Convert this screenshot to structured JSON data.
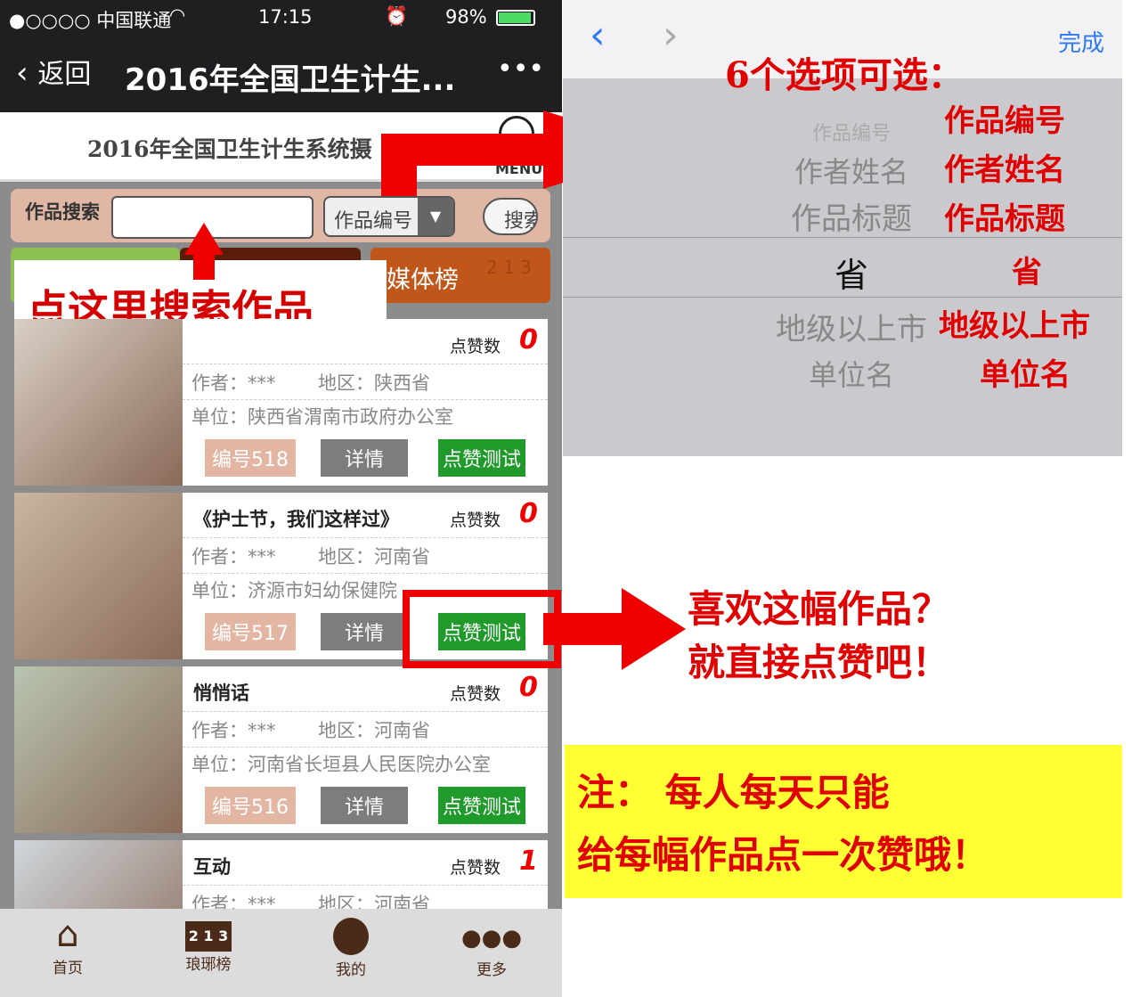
{
  "status": {
    "carrier": "●○○○○ 中国联通",
    "time": "17:15",
    "battery": "98%"
  },
  "nav": {
    "back": "返回",
    "title": "2016年全国卫生计生...",
    "more": "•••"
  },
  "header": {
    "title": "2016年全国卫生计生系统摄",
    "menu": "MENU"
  },
  "search": {
    "label": "作品搜索",
    "value": "",
    "select": "作品编号",
    "button": "搜索"
  },
  "tabs": [
    {
      "label": "媒体榜",
      "color": "#c0561a"
    }
  ],
  "overlay": {
    "search_hint": "点这里搜索作品"
  },
  "cards": [
    {
      "title": "",
      "likes_label": "点赞数",
      "likes": "0",
      "author": "作者：***",
      "region": "地区：陕西省",
      "unit": "单位：陕西省渭南市政府办公室",
      "id": "编号518",
      "detail": "详情",
      "vote": "点赞测试"
    },
    {
      "title": "《护士节，我们这样过》",
      "likes_label": "点赞数",
      "likes": "0",
      "author": "作者：***",
      "region": "地区：河南省",
      "unit": "单位：济源市妇幼保健院",
      "id": "编号517",
      "detail": "详情",
      "vote": "点赞测试"
    },
    {
      "title": "悄悄话",
      "likes_label": "点赞数",
      "likes": "0",
      "author": "作者：***",
      "region": "地区：河南省",
      "unit": "单位：河南省长垣县人民医院办公室",
      "id": "编号516",
      "detail": "详情",
      "vote": "点赞测试"
    },
    {
      "title": "互动",
      "likes_label": "点赞数",
      "likes": "1",
      "author": "作者：***",
      "region": "地区：河南省",
      "unit": "",
      "id": "",
      "detail": "",
      "vote": ""
    }
  ],
  "tabbar": [
    {
      "label": "首页",
      "icon": "home-icon"
    },
    {
      "label": "琅琊榜",
      "icon": "podium-icon"
    },
    {
      "label": "我的",
      "icon": "user-icon"
    },
    {
      "label": "更多",
      "icon": "more-icon"
    }
  ],
  "picker": {
    "done": "完成",
    "heading": "6个选项可选：",
    "options": [
      "作品编号",
      "作者姓名",
      "作品标题",
      "省",
      "地级以上市",
      "单位名"
    ],
    "selected": "省"
  },
  "annotations": {
    "like_hint_1": "喜欢这幅作品？",
    "like_hint_2": "就直接点赞吧！",
    "note_1": "注：  每人每天只能",
    "note_2": "给每幅作品点一次赞哦！"
  },
  "colors": {
    "accent_red": "#e00000",
    "vote_green": "#1f9a2b",
    "id_badge": "#e2b6a3",
    "detail_gray": "#7d7d7d",
    "brown": "#4a2a18",
    "note_bg": "#ffff33"
  }
}
